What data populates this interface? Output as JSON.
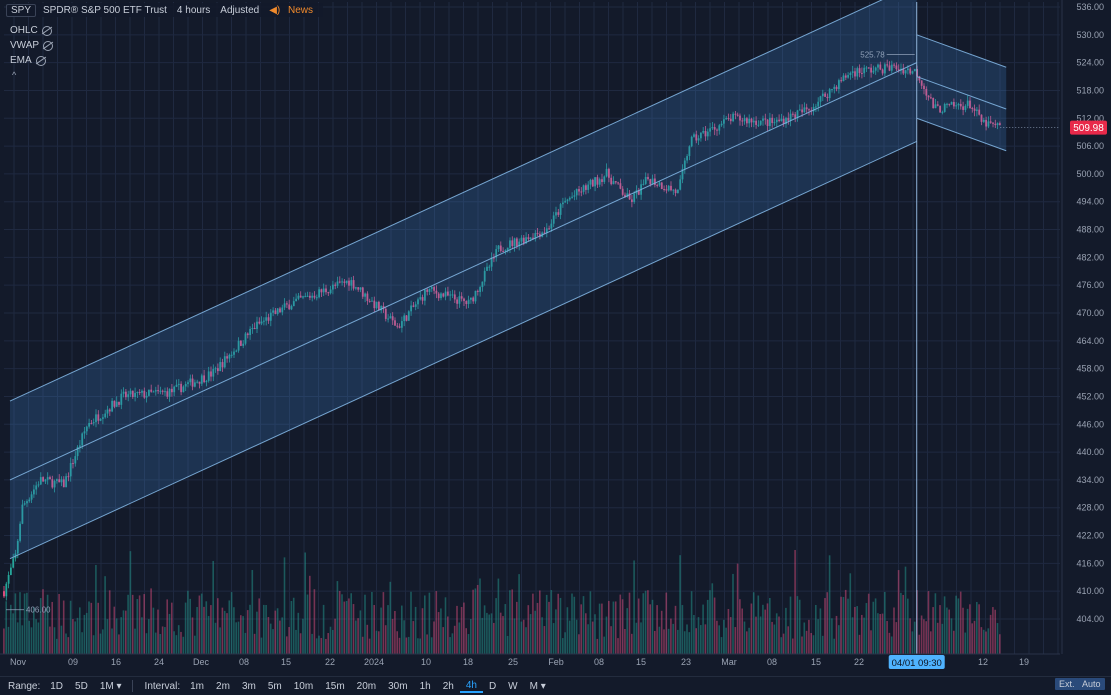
{
  "header": {
    "symbol": "SPY",
    "name": "SPDR® S&P 500 ETF Trust",
    "interval": "4 hours",
    "adjusted": "Adjusted",
    "news": "News"
  },
  "indicators": [
    "OHLC",
    "VWAP",
    "EMA"
  ],
  "price_axis": {
    "ticks": [
      "536.00",
      "530.00",
      "524.00",
      "518.00",
      "512.00",
      "506.00",
      "500.00",
      "494.00",
      "488.00",
      "482.00",
      "476.00",
      "470.00",
      "464.00",
      "458.00",
      "452.00",
      "446.00",
      "440.00",
      "434.00",
      "428.00",
      "422.00",
      "416.00",
      "410.00",
      "404.00"
    ],
    "last_price": "509.98",
    "last_price_color": "#e8294a"
  },
  "time_axis": {
    "labels": [
      "Nov",
      "09",
      "16",
      "24",
      "Dec",
      "08",
      "15",
      "22",
      "2024",
      "10",
      "18",
      "25",
      "Feb",
      "08",
      "15",
      "23",
      "Mar",
      "08",
      "15",
      "22",
      "04/01 09:30",
      "12",
      "19"
    ],
    "crosshair_label": "04/01 09:30"
  },
  "annotations": {
    "high_label": "525.78",
    "low_label": "406.00"
  },
  "bottom": {
    "range_label": "Range:",
    "ranges": [
      "1D",
      "5D",
      "1M ▾"
    ],
    "interval_label": "Interval:",
    "intervals": [
      "1m",
      "2m",
      "3m",
      "5m",
      "10m",
      "15m",
      "20m",
      "30m",
      "1h",
      "2h",
      "4h",
      "D",
      "W",
      "M ▾"
    ],
    "active_interval": "4h",
    "ext": "Ext.",
    "auto": "Auto"
  },
  "colors": {
    "up": "#26a69a",
    "down": "#ef5386",
    "channel": "#7fb3e0",
    "grid": "#1f2940",
    "bg": "#131a2a"
  },
  "chart_data": {
    "type": "candlestick",
    "title": "SPY",
    "ylim": [
      400,
      538
    ],
    "x_start": "2023-10-31",
    "x_end": "2024-04-22",
    "approx_close_path": [
      {
        "x": "2023-10-31",
        "y": 410
      },
      {
        "x": "2023-11-02",
        "y": 418
      },
      {
        "x": "2023-11-03",
        "y": 428
      },
      {
        "x": "2023-11-06",
        "y": 434
      },
      {
        "x": "2023-11-10",
        "y": 433
      },
      {
        "x": "2023-11-14",
        "y": 446
      },
      {
        "x": "2023-11-20",
        "y": 452
      },
      {
        "x": "2023-11-28",
        "y": 453
      },
      {
        "x": "2023-12-05",
        "y": 457
      },
      {
        "x": "2023-12-12",
        "y": 467
      },
      {
        "x": "2023-12-18",
        "y": 472
      },
      {
        "x": "2023-12-28",
        "y": 477
      },
      {
        "x": "2024-01-05",
        "y": 467
      },
      {
        "x": "2024-01-10",
        "y": 475
      },
      {
        "x": "2024-01-17",
        "y": 472
      },
      {
        "x": "2024-01-22",
        "y": 484
      },
      {
        "x": "2024-01-30",
        "y": 488
      },
      {
        "x": "2024-02-02",
        "y": 494
      },
      {
        "x": "2024-02-09",
        "y": 500
      },
      {
        "x": "2024-02-13",
        "y": 494
      },
      {
        "x": "2024-02-16",
        "y": 499
      },
      {
        "x": "2024-02-21",
        "y": 496
      },
      {
        "x": "2024-02-23",
        "y": 507
      },
      {
        "x": "2024-03-01",
        "y": 512
      },
      {
        "x": "2024-03-08",
        "y": 511
      },
      {
        "x": "2024-03-14",
        "y": 514
      },
      {
        "x": "2024-03-21",
        "y": 522
      },
      {
        "x": "2024-03-28",
        "y": 523
      },
      {
        "x": "2024-04-01",
        "y": 522
      },
      {
        "x": "2024-04-04",
        "y": 514
      },
      {
        "x": "2024-04-10",
        "y": 515
      },
      {
        "x": "2024-04-12",
        "y": 511
      },
      {
        "x": "2024-04-15",
        "y": 509.98
      }
    ],
    "channels": [
      {
        "name": "upward",
        "start": {
          "x": "2023-11-01",
          "y": 434
        },
        "end": {
          "x": "2024-04-01",
          "y": 524
        },
        "width": 17
      },
      {
        "name": "downward",
        "start": {
          "x": "2024-04-01",
          "y": 521
        },
        "end": {
          "x": "2024-04-16",
          "y": 514
        },
        "width": 9
      }
    ],
    "price_labels": [
      525.78,
      406.0
    ],
    "last_price": 509.98
  }
}
